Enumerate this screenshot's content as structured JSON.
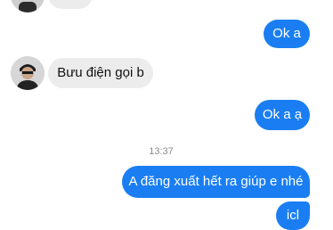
{
  "conversation": {
    "messages": [
      {
        "direction": "outgoing",
        "text": "Ok a"
      },
      {
        "direction": "incoming",
        "text": "Bưu điện gọi b"
      },
      {
        "direction": "outgoing",
        "text": "Ok a ạ"
      },
      {
        "direction": "outgoing",
        "text": "A đăng xuất hết ra giúp e nhé"
      },
      {
        "direction": "outgoing",
        "text": "icl"
      }
    ],
    "timestamp": "13:37"
  },
  "colors": {
    "outgoing_bubble": "#1a7ef2",
    "incoming_bubble": "#ececec",
    "background": "#ffffff"
  },
  "icons": {
    "contact_avatar": "contact-avatar-photo"
  }
}
